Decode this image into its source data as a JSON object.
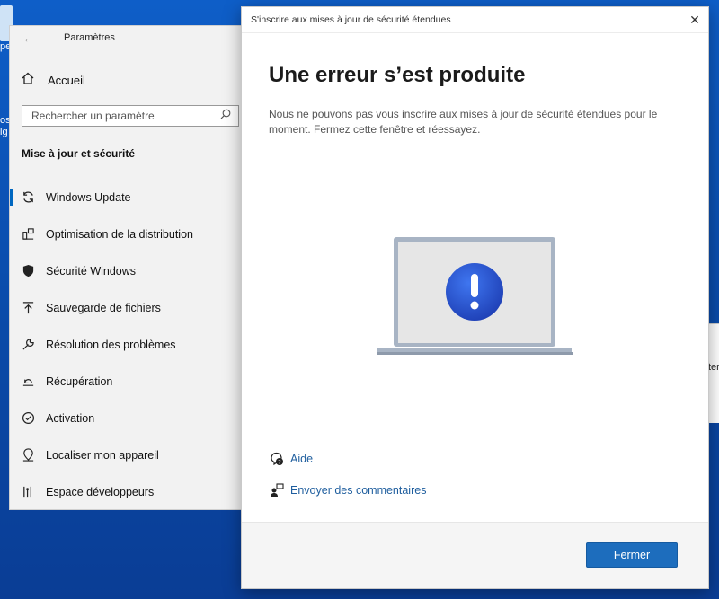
{
  "desktop": {
    "icon_text_top": "pe",
    "icon_text_mid_1": "os",
    "icon_text_mid_2": "lg",
    "side_window_text": "ter"
  },
  "settings": {
    "title": "Paramètres",
    "home_label": "Accueil",
    "search_placeholder": "Rechercher un paramètre",
    "section_title": "Mise à jour et sécurité",
    "items": [
      {
        "label": "Windows Update",
        "icon": "refresh-icon"
      },
      {
        "label": "Optimisation de la distribution",
        "icon": "delivery-icon"
      },
      {
        "label": "Sécurité Windows",
        "icon": "shield-icon"
      },
      {
        "label": "Sauvegarde de fichiers",
        "icon": "upload-icon"
      },
      {
        "label": "Résolution des problèmes",
        "icon": "wrench-icon"
      },
      {
        "label": "Récupération",
        "icon": "recovery-icon"
      },
      {
        "label": "Activation",
        "icon": "check-circle-icon"
      },
      {
        "label": "Localiser mon appareil",
        "icon": "locate-icon"
      },
      {
        "label": "Espace développeurs",
        "icon": "developer-icon"
      }
    ]
  },
  "dialog": {
    "title": "S'inscrire aux mises à jour de sécurité étendues",
    "heading": "Une erreur s’est produite",
    "message": "Nous ne pouvons pas vous inscrire aux mises à jour de sécurité étendues pour le moment. Fermez cette fenêtre et réessayez.",
    "help_label": "Aide",
    "feedback_label": "Envoyer des commentaires",
    "close_button": "Fermer",
    "accent_color": "#1d6dbd"
  }
}
